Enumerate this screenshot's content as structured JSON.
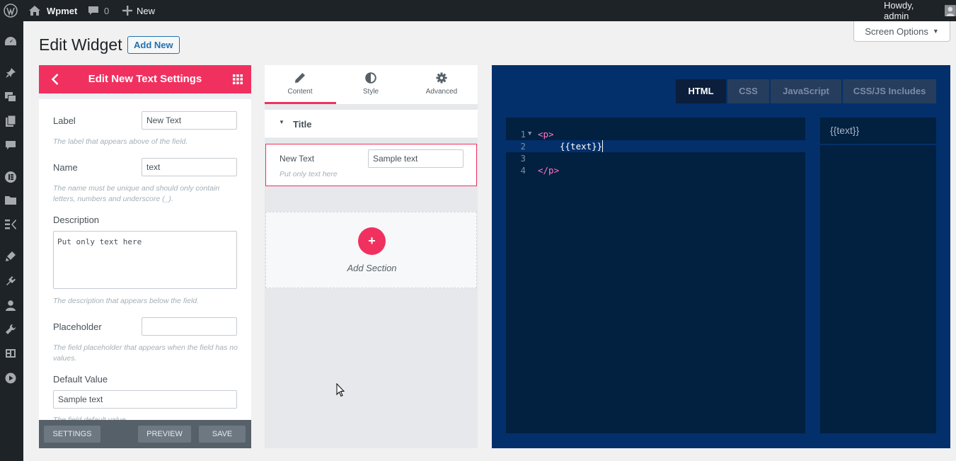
{
  "adminbar": {
    "site_name": "Wpmet",
    "comments_count": "0",
    "new_label": "New",
    "greeting": "Howdy, admin"
  },
  "page": {
    "title": "Edit Widget",
    "add_new": "Add New",
    "screen_options": "Screen Options"
  },
  "settings_panel": {
    "title": "Edit New Text Settings",
    "fields": {
      "label": {
        "label": "Label",
        "value": "New Text",
        "hint": "The label that appears above of the field."
      },
      "name": {
        "label": "Name",
        "value": "text",
        "hint": "The name must be unique and should only contain letters, numbers and underscore (_)."
      },
      "description": {
        "label": "Description",
        "value": "Put only text here",
        "hint": "The description that appears below the field."
      },
      "placeholder": {
        "label": "Placeholder",
        "value": "",
        "hint": "The field placeholder that appears when the field has no values."
      },
      "default_value": {
        "label": "Default Value",
        "value": "Sample text",
        "hint": "The field default value"
      }
    },
    "footer": {
      "settings": "SETTINGS",
      "preview": "PREVIEW",
      "save": "SAVE"
    }
  },
  "preview_panel": {
    "tabs": [
      {
        "label": "Content",
        "icon": "pencil-icon"
      },
      {
        "label": "Style",
        "icon": "half-circle-icon"
      },
      {
        "label": "Advanced",
        "icon": "gear-icon"
      }
    ],
    "section_title": "Title",
    "field": {
      "label": "New Text",
      "value": "Sample text",
      "description": "Put only text here"
    },
    "add_section": "Add Section"
  },
  "code_panel": {
    "tabs": [
      "HTML",
      "CSS",
      "JavaScript",
      "CSS/JS Includes"
    ],
    "active_tab": "HTML",
    "lines": [
      {
        "num": "1",
        "code": "<p>"
      },
      {
        "num": "2",
        "code": "{{text}}"
      },
      {
        "num": "3",
        "code": ""
      },
      {
        "num": "4",
        "code": "</p>"
      }
    ],
    "preview_output": "{{text}}"
  },
  "colors": {
    "accent": "#f0315f",
    "editor_bg": "#02203f",
    "editor_panel": "#03306b",
    "admin_bar": "#1d2327"
  }
}
